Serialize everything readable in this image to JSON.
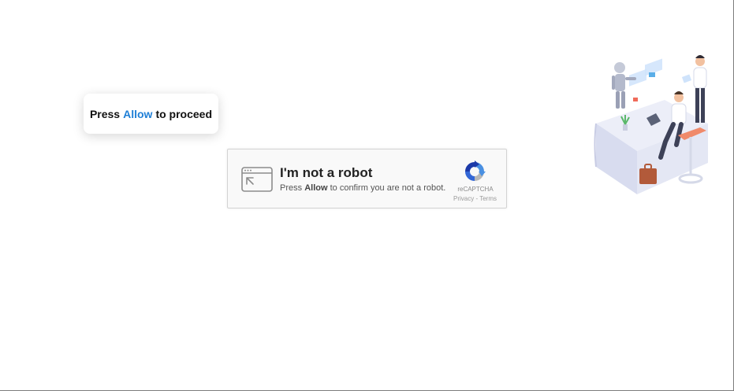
{
  "prompt": {
    "prefix": "Press",
    "highlight": "Allow",
    "suffix": "to proceed",
    "accent_color": "#1f7fd6"
  },
  "captcha": {
    "title": "I'm not a robot",
    "subtitle_prefix": "Press",
    "subtitle_bold": "Allow",
    "subtitle_suffix": "to confirm you are not a robot.",
    "brand": "reCAPTCHA",
    "privacy_link": "Privacy",
    "separator": "-",
    "terms_link": "Terms",
    "icon": "browser-cursor-icon"
  },
  "illustration": {
    "icon": "office-robot-illustration"
  }
}
